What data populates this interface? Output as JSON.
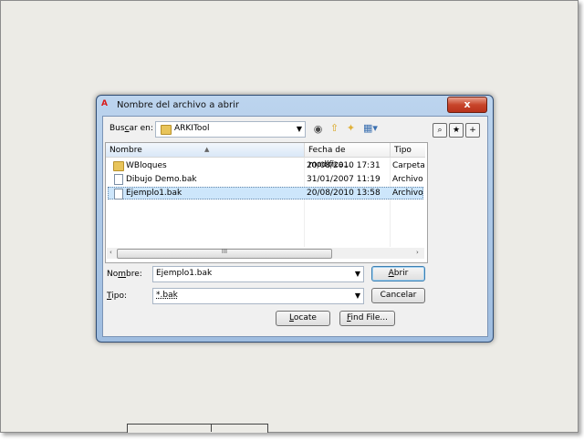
{
  "dialog": {
    "title": "Nombre del archivo a abrir",
    "app_icon_text": "A",
    "close_label": "x"
  },
  "lookin": {
    "label_before": "Bus",
    "label_accel": "c",
    "label_after": "ar en:",
    "value": "ARKITool"
  },
  "toolbar": {
    "back_icon": "back-icon",
    "up_icon": "folder-up-icon",
    "new_folder_icon": "new-folder-icon",
    "views_icon": "views-icon"
  },
  "list": {
    "columns": [
      "Nombre",
      "Fecha de modifica...",
      "Tipo"
    ],
    "rows": [
      {
        "name": "WBloques",
        "date": "20/08/2010 17:31",
        "type": "Carpeta",
        "kind": "folder"
      },
      {
        "name": "Dibujo Demo.bak",
        "date": "31/01/2007 11:19",
        "type": "Archivo",
        "kind": "file"
      },
      {
        "name": "Ejemplo1.bak",
        "date": "20/08/2010 13:58",
        "type": "Archivo",
        "kind": "file",
        "selected": true
      }
    ],
    "scroll_left": "‹",
    "scroll_right": "›",
    "scroll_grip": "III"
  },
  "form": {
    "name_label_accel": "m",
    "name_label_before": "No",
    "name_label_after": "bre:",
    "name_value": "Ejemplo1.bak",
    "type_label_accel": "T",
    "type_label_after": "ipo:",
    "type_value": "*.bak"
  },
  "buttons": {
    "open_accel": "A",
    "open_rest": "brir",
    "cancel": "Cancelar",
    "locate_accel": "L",
    "locate_rest": "ocate",
    "find_accel": "F",
    "find_rest": "ind File..."
  },
  "colors": {
    "close_button": "#c8452b",
    "selection": "#cde6fb",
    "folder": "#e8c45a"
  }
}
